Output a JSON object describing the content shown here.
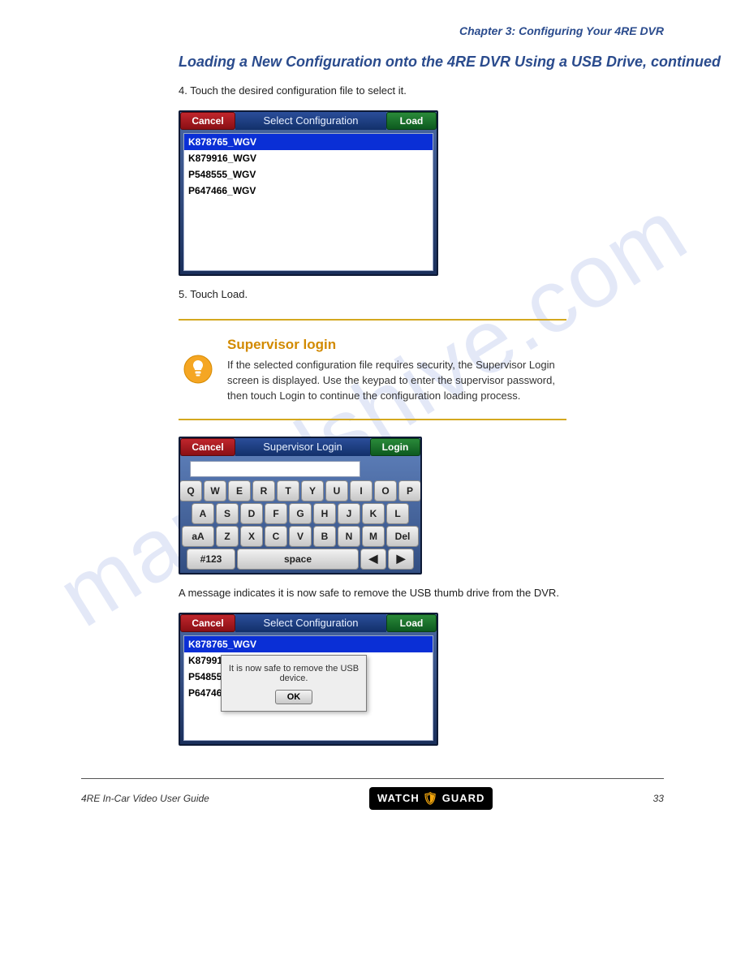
{
  "chapter_header": "Chapter 3: Configuring Your 4RE DVR",
  "section_heading": "Loading a New Configuration onto the 4RE DVR Using a USB Drive, continued",
  "step4_text": "4.  Touch the desired configuration file to select it.",
  "screenshot1": {
    "cancel": "Cancel",
    "title": "Select Configuration",
    "load": "Load",
    "items": [
      "K878765_WGV",
      "K879916_WGV",
      "P548555_WGV",
      "P647466_WGV"
    ]
  },
  "step5_text": "5.  Touch Load.",
  "tip": {
    "heading": "Supervisor login",
    "body": "If the selected configuration file requires security, the Supervisor Login screen is displayed. Use the keypad to enter the supervisor password, then touch Login to continue the configuration loading process."
  },
  "screenshot2": {
    "cancel": "Cancel",
    "title": "Supervisor Login",
    "login": "Login",
    "keyboard": {
      "row1": [
        "Q",
        "W",
        "E",
        "R",
        "T",
        "Y",
        "U",
        "I",
        "O",
        "P"
      ],
      "row2": [
        "A",
        "S",
        "D",
        "F",
        "G",
        "H",
        "J",
        "K",
        "L"
      ],
      "row3_shift": "aA",
      "row3": [
        "Z",
        "X",
        "C",
        "V",
        "B",
        "N",
        "M"
      ],
      "row3_del": "Del",
      "numsym": "#123",
      "space": "space",
      "left": "◀",
      "right": "▶"
    }
  },
  "post_kbd_text": "A message indicates it is now safe to remove the USB thumb drive from the DVR.",
  "screenshot3": {
    "cancel": "Cancel",
    "title": "Select Configuration",
    "load": "Load",
    "items": [
      "K878765_WGV",
      "K879916_WGV",
      "P548555_WGV",
      "P647466_WGV"
    ],
    "dialog_text": "It is now safe to remove the USB device.",
    "dialog_ok": "OK"
  },
  "footer": {
    "left": "4RE In-Car Video User Guide",
    "logo_left": "WATCH",
    "logo_right": "GUARD",
    "page": "33"
  }
}
